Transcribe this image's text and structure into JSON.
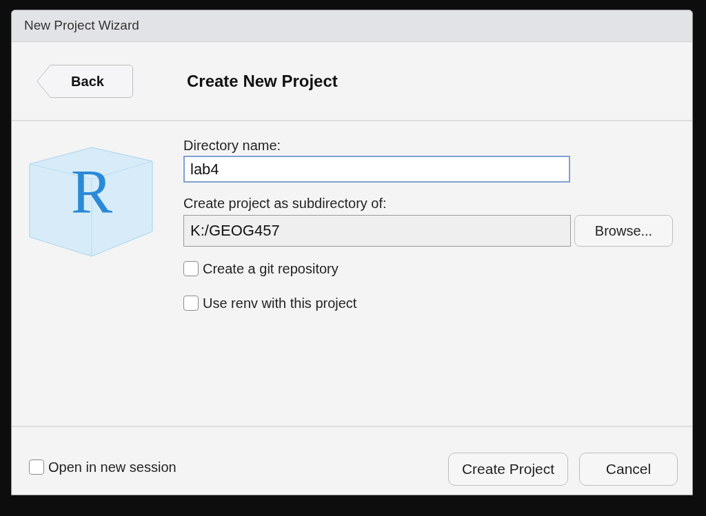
{
  "window": {
    "title": "New Project Wizard"
  },
  "header": {
    "back_button": "Back",
    "title": "Create New Project"
  },
  "logo": {
    "letter": "R"
  },
  "form": {
    "directory_label": "Directory name:",
    "directory_value": "lab4",
    "directory_focused": true,
    "parent_label": "Create project as subdirectory of:",
    "parent_value": "K:/GEOG457",
    "browse_button": "Browse...",
    "options": [
      {
        "label": "Create a git repository",
        "checked": false
      },
      {
        "label": "Use renv with this project",
        "checked": false
      }
    ]
  },
  "footer": {
    "open_new_session": {
      "label": "Open in new session",
      "checked": false
    },
    "buttons": [
      {
        "label": "Create Project"
      },
      {
        "label": "Cancel"
      }
    ]
  }
}
